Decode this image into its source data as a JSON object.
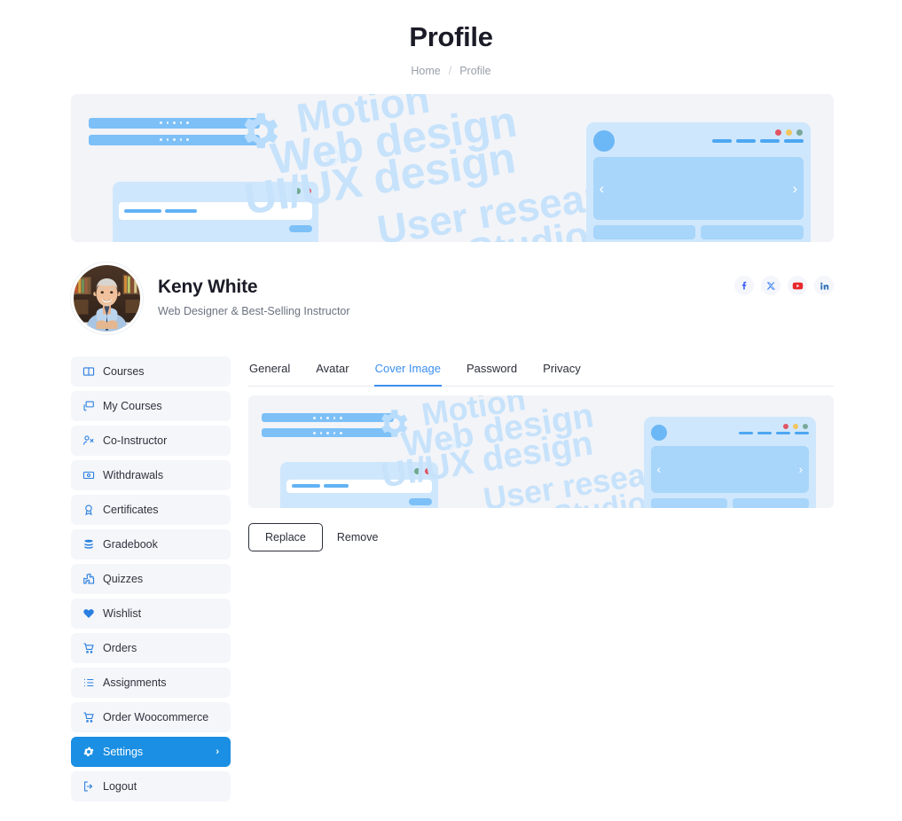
{
  "header": {
    "title": "Profile",
    "breadcrumb": {
      "home": "Home",
      "separator": "/",
      "current": "Profile"
    }
  },
  "cover": {
    "wordmarks": {
      "motion": "Motion",
      "web_design": "Web design",
      "uiux_design": "UI/UX design",
      "user_research": "User research",
      "studio": "Studio al"
    },
    "window_dots": [
      "#6fa98f",
      "#e05563"
    ],
    "browser_dots": [
      "#e05563",
      "#f2c55c",
      "#7aa79a"
    ],
    "carousel_prev": "‹",
    "carousel_next": "›"
  },
  "profile": {
    "name": "Keny White",
    "tagline": "Web Designer & Best-Selling Instructor",
    "avatar_alt": "avatar",
    "socials": [
      {
        "name": "facebook",
        "label": "Facebook",
        "color": "#3b5bf5"
      },
      {
        "name": "x-twitter",
        "label": "X",
        "color": "#3b82f6"
      },
      {
        "name": "youtube",
        "label": "YouTube",
        "color": "#e8282b"
      },
      {
        "name": "linkedin",
        "label": "LinkedIn",
        "color": "#2f6fb5"
      }
    ]
  },
  "sidebar": {
    "items": [
      {
        "label": "Courses",
        "icon": "book-icon",
        "active": false
      },
      {
        "label": "My Courses",
        "icon": "my-courses-icon",
        "active": false
      },
      {
        "label": "Co-Instructor",
        "icon": "co-instructor-icon",
        "active": false
      },
      {
        "label": "Withdrawals",
        "icon": "withdrawals-icon",
        "active": false
      },
      {
        "label": "Certificates",
        "icon": "certificate-icon",
        "active": false
      },
      {
        "label": "Gradebook",
        "icon": "gradebook-icon",
        "active": false
      },
      {
        "label": "Quizzes",
        "icon": "quiz-icon",
        "active": false
      },
      {
        "label": "Wishlist",
        "icon": "heart-icon",
        "active": false
      },
      {
        "label": "Orders",
        "icon": "cart-icon",
        "active": false
      },
      {
        "label": "Assignments",
        "icon": "assignments-icon",
        "active": false
      },
      {
        "label": "Order Woocommerce",
        "icon": "cart-icon",
        "active": false
      },
      {
        "label": "Settings",
        "icon": "gear-icon",
        "active": true,
        "chevron": "›"
      },
      {
        "label": "Logout",
        "icon": "logout-icon",
        "active": false
      }
    ]
  },
  "tabs": [
    {
      "label": "General",
      "active": false
    },
    {
      "label": "Avatar",
      "active": false
    },
    {
      "label": "Cover Image",
      "active": true
    },
    {
      "label": "Password",
      "active": false
    },
    {
      "label": "Privacy",
      "active": false
    }
  ],
  "actions": {
    "replace_label": "Replace",
    "remove_label": "Remove"
  },
  "colors": {
    "accent": "#1a8fe3",
    "tab_active": "#3b8ff0",
    "sidebar_item_bg": "#f4f6fa",
    "cover_bg": "#f2f4f8",
    "wordmark": "#c7e2fb",
    "title": "#1b1b27",
    "muted": "#9aa0aa"
  }
}
